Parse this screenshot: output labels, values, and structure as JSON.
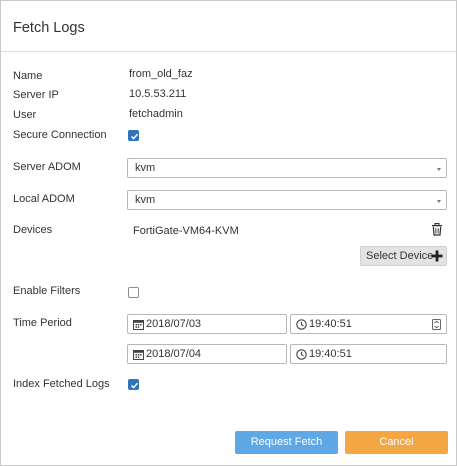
{
  "dialog": {
    "title": "Fetch Logs"
  },
  "form": {
    "name_label": "Name",
    "name_value": "from_old_faz",
    "server_ip_label": "Server IP",
    "server_ip_value": "10.5.53.211",
    "user_label": "User",
    "user_value": "fetchadmin",
    "secure_connection_label": "Secure Connection",
    "secure_connection_checked": true,
    "server_adom_label": "Server ADOM",
    "server_adom_value": "kvm",
    "local_adom_label": "Local ADOM",
    "local_adom_value": "kvm",
    "devices_label": "Devices",
    "devices": [
      "FortiGate-VM64-KVM"
    ],
    "select_device_label": "Select Device",
    "enable_filters_label": "Enable Filters",
    "enable_filters_checked": false,
    "time_period_label": "Time Period",
    "start_date": "2018/07/03",
    "start_time": "19:40:51",
    "end_date": "2018/07/04",
    "end_time": "19:40:51",
    "index_fetched_logs_label": "Index Fetched Logs",
    "index_fetched_logs_checked": true
  },
  "footer": {
    "request_fetch_label": "Request Fetch",
    "cancel_label": "Cancel"
  },
  "colors": {
    "checkbox_checked": "#2f75bd",
    "primary_button": "#5fa8e6",
    "cancel_button": "#f4a643"
  },
  "icons": [
    "checkmark-icon",
    "dropdown-caret-icon",
    "trash-icon",
    "plus-icon",
    "calendar-icon",
    "clock-icon",
    "spinner-icon"
  ]
}
